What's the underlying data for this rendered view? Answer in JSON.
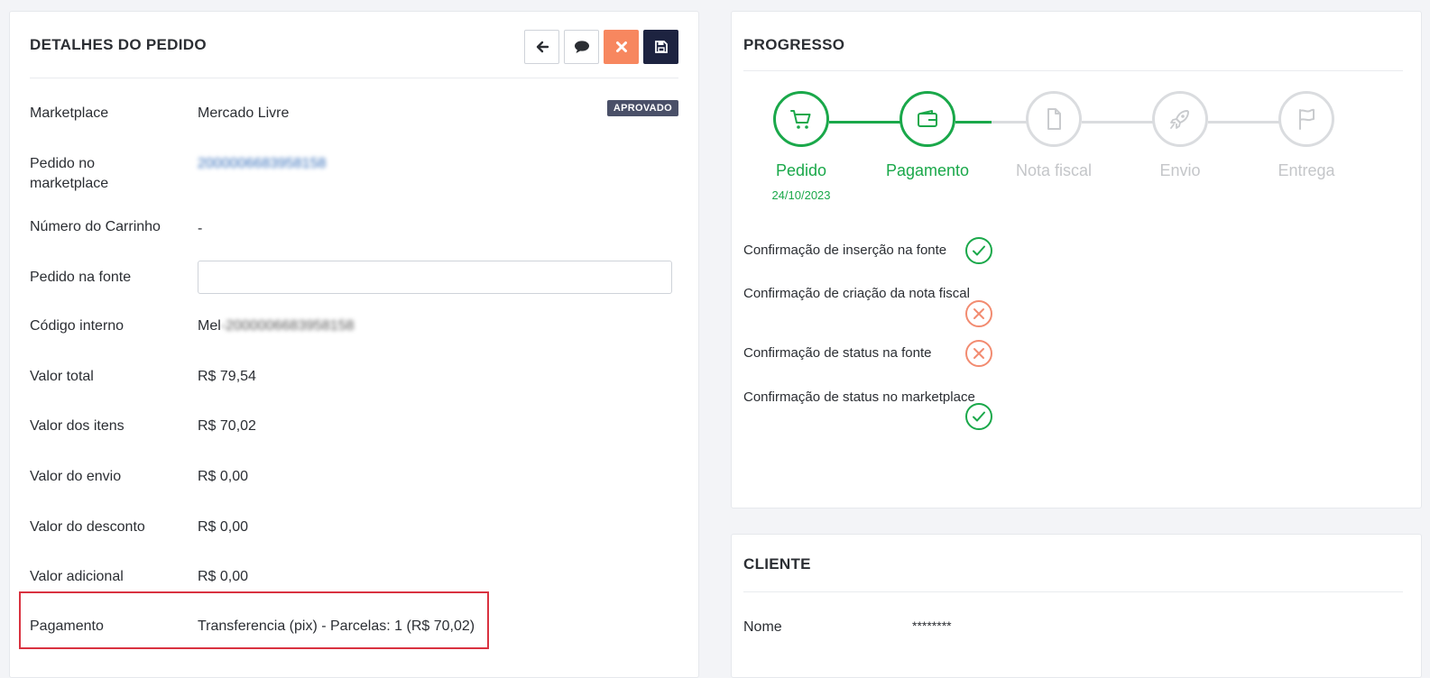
{
  "details": {
    "title": "DETALHES DO PEDIDO",
    "badge": "APROVADO",
    "rows": [
      {
        "label": "Marketplace",
        "value": "Mercado Livre"
      },
      {
        "label": "Pedido no marketplace",
        "value": "2000006683958158"
      },
      {
        "label": "Número do Carrinho",
        "value": "-"
      },
      {
        "label": "Pedido na fonte",
        "value": ""
      },
      {
        "label": "Código interno",
        "value_prefix": "Mel",
        "value": "-2000006683958158"
      },
      {
        "label": "Valor total",
        "value": "R$ 79,54"
      },
      {
        "label": "Valor dos itens",
        "value": "R$ 70,02"
      },
      {
        "label": "Valor do envio",
        "value": "R$ 0,00"
      },
      {
        "label": "Valor do desconto",
        "value": "R$ 0,00"
      },
      {
        "label": "Valor adicional",
        "value": "R$ 0,00"
      },
      {
        "label": "Pagamento",
        "value": "Transferencia (pix) - Parcelas: 1 (R$ 70,02)"
      }
    ],
    "toolbar_icons": [
      "arrow-left-icon",
      "comment-icon",
      "close-icon",
      "save-icon"
    ]
  },
  "progress": {
    "title": "PROGRESSO",
    "steps": [
      {
        "label": "Pedido",
        "date": "24/10/2023",
        "status": "done",
        "icon": "cart-icon"
      },
      {
        "label": "Pagamento",
        "date": "",
        "status": "done",
        "icon": "wallet-icon"
      },
      {
        "label": "Nota fiscal",
        "date": "",
        "status": "todo",
        "icon": "file-icon"
      },
      {
        "label": "Envio",
        "date": "",
        "status": "todo",
        "icon": "rocket-icon"
      },
      {
        "label": "Entrega",
        "date": "",
        "status": "todo",
        "icon": "flag-icon"
      }
    ],
    "checks": [
      {
        "label": "Confirmação de inserção na fonte",
        "status": "ok"
      },
      {
        "label": "Confirmação de criação da nota fiscal",
        "status": "fail"
      },
      {
        "label": "Confirmação de status na fonte",
        "status": "fail"
      },
      {
        "label": "Confirmação de status no marketplace",
        "status": "ok"
      }
    ],
    "colors": {
      "done": "#1aa84a",
      "todo": "#dadcdf",
      "fail": "#f28b70"
    }
  },
  "client": {
    "title": "CLIENTE",
    "rows": [
      {
        "label": "Nome",
        "value": "********"
      }
    ]
  }
}
